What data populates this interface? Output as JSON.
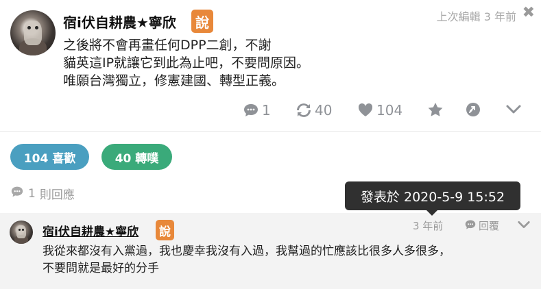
{
  "post": {
    "author": "宿i伏自耕農★寧欣",
    "badge": "說",
    "edited": "上次編輯 3 年前",
    "content": [
      "之後將不會再畫任何DPP二創，不謝",
      "貓英這IP就讓它到此為止吧，不要問原因。",
      "唯願台灣獨立，修憲建國、轉型正義。"
    ],
    "actions": {
      "comments": "1",
      "reposts": "40",
      "likes": "104"
    },
    "icons": [
      "comment-icon",
      "repost-icon",
      "heart-icon",
      "star-icon",
      "link-icon",
      "chevron-down-icon",
      "close-icon"
    ]
  },
  "stats": {
    "likes_pill": "104 喜歡",
    "shares_pill": "40 轉噗"
  },
  "replies": {
    "count": "1",
    "label": "則回應"
  },
  "tooltip": {
    "text": "發表於 2020-5-9 15:52"
  },
  "reply": {
    "author": "宿i伏自耕農★寧欣",
    "badge": "說",
    "time": "3 年前",
    "reply_label": "回覆",
    "content": [
      "我從來都沒有入黨過，我也慶幸我沒有入過，我幫過的忙應該比很多人多很多，",
      "不要問就是最好的分手"
    ]
  },
  "colors": {
    "badge": "#e8883a",
    "likes_pill": "#4a9fc0",
    "shares_pill": "#3aaa7a",
    "muted": "#8f9297",
    "tooltip_bg": "#303030",
    "comment_bg": "#f3f3f3"
  }
}
